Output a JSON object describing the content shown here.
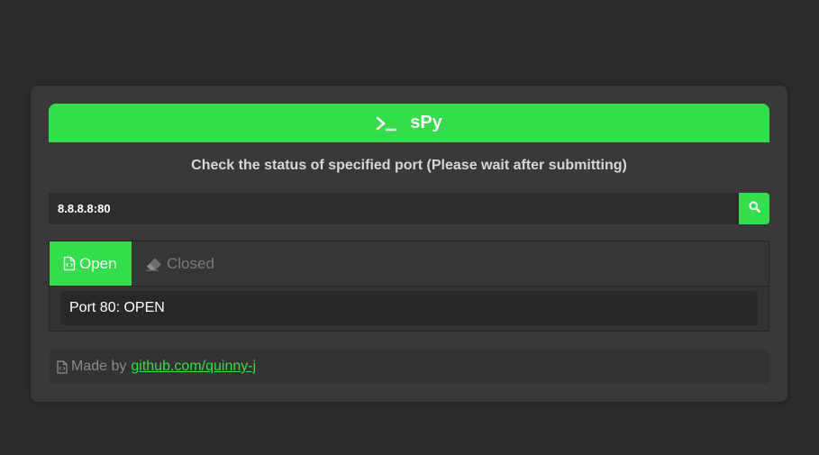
{
  "app": {
    "title": "sPy",
    "subtitle": "Check the status of specified port (Please wait after submitting)"
  },
  "search": {
    "value": "8.8.8.8:80",
    "button_icon": "search-icon"
  },
  "tabs": [
    {
      "label": "Open",
      "icon": "file-code-icon",
      "active": true
    },
    {
      "label": "Closed",
      "icon": "eraser-icon",
      "active": false
    }
  ],
  "result": {
    "text": "Port 80: OPEN"
  },
  "footer": {
    "prefix": "Made by",
    "link_text": "github.com/quinny-j"
  },
  "colors": {
    "accent": "#33dd4c",
    "background": "#2b2b2b",
    "card": "#393939"
  }
}
